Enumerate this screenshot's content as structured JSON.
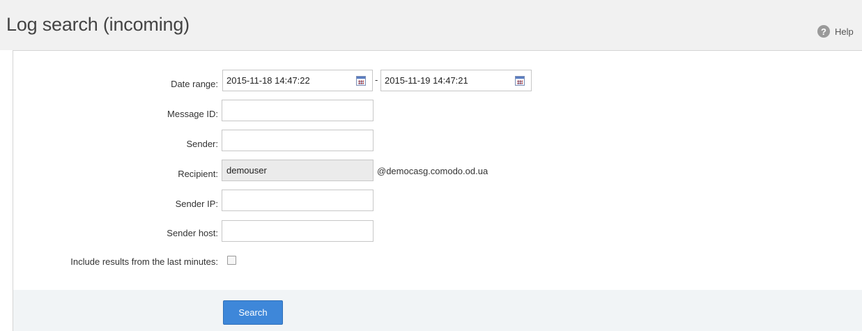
{
  "header": {
    "title": "Log search (incoming)",
    "help_label": "Help",
    "help_icon": "question-circle-icon"
  },
  "form": {
    "date_range": {
      "label": "Date range:",
      "from": "2015-11-18 14:47:22",
      "separator": "-",
      "to": "2015-11-19 14:47:21",
      "calendar_icon": "calendar-icon"
    },
    "message_id": {
      "label": "Message ID:",
      "value": ""
    },
    "sender": {
      "label": "Sender:",
      "value": ""
    },
    "recipient": {
      "label": "Recipient:",
      "value": "demouser",
      "domain": "@democasg.comodo.od.ua"
    },
    "sender_ip": {
      "label": "Sender IP:",
      "value": ""
    },
    "sender_host": {
      "label": "Sender host:",
      "value": ""
    },
    "include_last_minutes": {
      "label": "Include results from the last minutes:",
      "checked": false
    }
  },
  "actions": {
    "search_label": "Search",
    "search_color": "#3e87d9"
  }
}
